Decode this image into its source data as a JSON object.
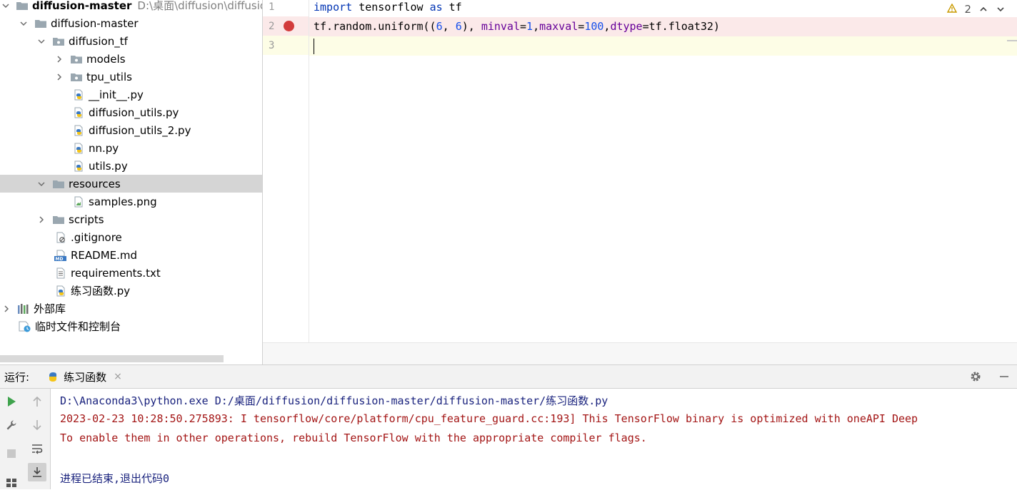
{
  "project_tree": {
    "root": {
      "label": "diffusion-master",
      "path": "D:\\桌面\\diffusion\\diffusion"
    },
    "items": [
      {
        "label": "diffusion-master",
        "icon": "folder-icon"
      },
      {
        "label": "diffusion_tf",
        "icon": "package-folder-icon"
      },
      {
        "label": "models",
        "icon": "package-folder-icon"
      },
      {
        "label": "tpu_utils",
        "icon": "package-folder-icon"
      },
      {
        "label": "__init__.py",
        "icon": "python-file-icon"
      },
      {
        "label": "diffusion_utils.py",
        "icon": "python-file-icon"
      },
      {
        "label": "diffusion_utils_2.py",
        "icon": "python-file-icon"
      },
      {
        "label": "nn.py",
        "icon": "python-file-icon"
      },
      {
        "label": "utils.py",
        "icon": "python-file-icon"
      },
      {
        "label": "resources",
        "icon": "folder-icon"
      },
      {
        "label": "samples.png",
        "icon": "image-file-icon"
      },
      {
        "label": "scripts",
        "icon": "folder-icon"
      },
      {
        "label": ".gitignore",
        "icon": "ignore-file-icon"
      },
      {
        "label": "README.md",
        "icon": "markdown-file-icon"
      },
      {
        "label": "requirements.txt",
        "icon": "text-file-icon"
      },
      {
        "label": "练习函数.py",
        "icon": "python-file-icon"
      },
      {
        "label": "外部库",
        "icon": "library-icon"
      },
      {
        "label": "临时文件和控制台",
        "icon": "scratch-icon"
      }
    ]
  },
  "editor": {
    "line_numbers": [
      "1",
      "2",
      "3"
    ],
    "line1": {
      "kw_import": "import",
      "mod": " tensorflow ",
      "kw_as": "as",
      "alias": " tf"
    },
    "line2": {
      "a": "tf.random.uniform((",
      "n1": "6",
      "b": ", ",
      "n2": "6",
      "c": "), ",
      "p1": "minval",
      "d": "=",
      "n3": "1",
      "e": ",",
      "p2": "maxval",
      "f": "=",
      "n4": "100",
      "g": ",",
      "p3": "dtype",
      "h": "=tf.float32)"
    },
    "inspection_count": "2"
  },
  "run_panel": {
    "title": "运行:",
    "tab_label": "练习函数",
    "tab_close": "×",
    "lines": {
      "command": "D:\\Anaconda3\\python.exe D:/桌面/diffusion/diffusion-master/diffusion-master/练习函数.py",
      "log1": "2023-02-23 10:28:50.275893: I tensorflow/core/platform/cpu_feature_guard.cc:193] This TensorFlow binary is optimized with oneAPI Deep",
      "log2": "To enable them in other operations, rebuild TensorFlow with the appropriate compiler flags.",
      "exit": "进程已结束,退出代码0"
    }
  }
}
